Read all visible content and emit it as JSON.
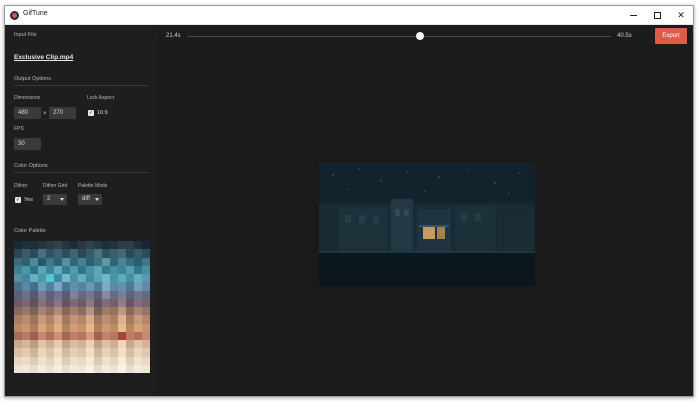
{
  "app": {
    "title": "GifTune",
    "icon": "app-logo-icon"
  },
  "window_controls": {
    "minimize_icon": "minimize-icon",
    "maximize_icon": "maximize-icon",
    "close_icon": "close-icon",
    "close_glyph": "✕"
  },
  "sidebar": {
    "input_file": {
      "section": "Input File",
      "filename": "Exclusive Clip.mp4"
    },
    "output_options": {
      "section": "Output Options",
      "dimensions_label": "Dimensions",
      "width": "480",
      "times": "×",
      "height": "270",
      "lock_aspect_label": "Lock Aspect",
      "lock_aspect_checked": true,
      "aspect_ratio": "16:9",
      "fps_label": "FPS",
      "fps": "30"
    },
    "color_options": {
      "section": "Color Options",
      "dither_label": "Dither",
      "dither_checked": true,
      "dither_value": "Yes",
      "dither_grid_label": "Dither Grid",
      "dither_grid_value": "2",
      "palette_mode_label": "Palette Mode",
      "palette_mode_value": "diff"
    },
    "color_palette": {
      "section": "Color Palette",
      "colors": [
        "#1b2a33",
        "#22323c",
        "#1f2f3a",
        "#27343d",
        "#2e3b44",
        "#34424c",
        "#253540",
        "#1c2b35",
        "#2a3842",
        "#31404a",
        "#263a45",
        "#1e303b",
        "#24343e",
        "#2c3b45",
        "#2f3e47",
        "#223039",
        "#1a2731",
        "#2b4552",
        "#3c5a68",
        "#2a4a5a",
        "#47707e",
        "#325263",
        "#3a6372",
        "#2c4d5e",
        "#3f6575",
        "#2d4757",
        "#365c6c",
        "#4a7383",
        "#2e5060",
        "#3b5f6e",
        "#426a7a",
        "#2b4858",
        "#375a69",
        "#2d4a58",
        "#3c6b7c",
        "#2f5e72",
        "#4d8a9a",
        "#28586c",
        "#3e7787",
        "#2a6477",
        "#55919f",
        "#30667a",
        "#47818f",
        "#2c5f73",
        "#3a7282",
        "#5b99a6",
        "#2e6579",
        "#4a8593",
        "#336d80",
        "#2c5c70",
        "#3f7686",
        "#3a7f93",
        "#4b97a8",
        "#2e7488",
        "#5aa5b4",
        "#3b8698",
        "#63a9b6",
        "#357d90",
        "#4f9aab",
        "#2f7588",
        "#4892a3",
        "#5da3b1",
        "#347b8e",
        "#46909f",
        "#3c8596",
        "#539dad",
        "#317789",
        "#4a8d9c",
        "#5b8fa0",
        "#3f88a0",
        "#6bb0bf",
        "#4a9ab0",
        "#5dc4d2",
        "#3c8aa3",
        "#7ab8c4",
        "#4b92a8",
        "#65aebf",
        "#3f8ba2",
        "#58a5b8",
        "#70b6c3",
        "#4795ab",
        "#5faabc",
        "#4a8fa5",
        "#68adbd",
        "#5a9aac",
        "#4d6f8a",
        "#5b87a6",
        "#43708f",
        "#6c9cb8",
        "#50809f",
        "#7aa8c0",
        "#4a7797",
        "#628fad",
        "#56839f",
        "#6a98b4",
        "#4e7c9c",
        "#7fa9c1",
        "#5a88a6",
        "#6691ae",
        "#4b7a99",
        "#739fb9",
        "#5e8aa7",
        "#5a5f78",
        "#6b6f8a",
        "#545a74",
        "#787b93",
        "#615f7a",
        "#6d7490",
        "#585d77",
        "#7e8199",
        "#63697f",
        "#72778f",
        "#5c6179",
        "#858aa0",
        "#676c84",
        "#7a7f96",
        "#5f647c",
        "#6e7389",
        "#656a82",
        "#6a5a66",
        "#7a6670",
        "#5f525e",
        "#86707a",
        "#705f6b",
        "#8a7680",
        "#665560",
        "#7c6a75",
        "#6c5c68",
        "#8e7884",
        "#62545f",
        "#7f6b76",
        "#745f6c",
        "#947d88",
        "#685762",
        "#826e79",
        "#75636f",
        "#8a6a5e",
        "#9c7768",
        "#7f6257",
        "#a88272",
        "#916f62",
        "#b08a78",
        "#866759",
        "#a47d6d",
        "#8c6b5e",
        "#b89280",
        "#7c5f54",
        "#a07a6a",
        "#93725f",
        "#bd9784",
        "#886a5c",
        "#a98473",
        "#977465",
        "#a87f64",
        "#b98c6e",
        "#9b745c",
        "#c69a78",
        "#ad8468",
        "#d2a582",
        "#a07a60",
        "#c29472",
        "#b08768",
        "#d8ac88",
        "#9c775d",
        "#be906f",
        "#ab8164",
        "#dcb18e",
        "#a47c61",
        "#c89b79",
        "#b3896b",
        "#b98a66",
        "#c8956e",
        "#ac7f5e",
        "#d6a37a",
        "#bf8f6b",
        "#e0ad84",
        "#b1835f",
        "#d09d75",
        "#c49270",
        "#e6b48b",
        "#ae805e",
        "#cc9873",
        "#bc8c68",
        "#e9b98f",
        "#b6885f",
        "#d5a27a",
        "#c6946e",
        "#a86a58",
        "#bb7a62",
        "#9c5f50",
        "#c8856b",
        "#b06f5b",
        "#d18f72",
        "#a36654",
        "#c07d66",
        "#b47562",
        "#d69a7c",
        "#a06253",
        "#c58269",
        "#b7785f",
        "#a8433c",
        "#c07a60",
        "#b56f5a",
        "#c28a70",
        "#c9a88c",
        "#d6b59a",
        "#bd9c82",
        "#e0c2a6",
        "#cfae92",
        "#e8caae",
        "#c4a387",
        "#dbbca0",
        "#d1b095",
        "#ecd0b4",
        "#c2a185",
        "#dfc0a4",
        "#cfae93",
        "#f0d6ba",
        "#c8a78b",
        "#e2c3a7",
        "#d4b398",
        "#d8c0a6",
        "#e2cbb1",
        "#cdb59c",
        "#ead4ba",
        "#dcc4aa",
        "#f0dac0",
        "#d2bba1",
        "#e6cfb5",
        "#ddc5ab",
        "#f2dcc2",
        "#d0b89e",
        "#e8d1b7",
        "#dac2a8",
        "#f4dfc5",
        "#d6bea4",
        "#ecd5bb",
        "#e0c8ae",
        "#e6d6c2",
        "#ecdcc8",
        "#dccbb7",
        "#f1e2ce",
        "#e4d3bf",
        "#f4e6d3",
        "#ddccb8",
        "#eedfcb",
        "#e8d8c4",
        "#f6e9d6",
        "#dac9b5",
        "#f0e1cd",
        "#e6d5c1",
        "#f8ecda",
        "#dfceba",
        "#f2e3cf",
        "#e9d9c5",
        "#efe3d4",
        "#f2e7d8",
        "#e8dccd",
        "#f5ebdd",
        "#ece0d1",
        "#f7eee1",
        "#e9ddce",
        "#f3e9db",
        "#efe4d5",
        "#f8f0e4",
        "#e6dacb",
        "#f4eadc",
        "#ede2d3",
        "#f9f2e7",
        "#eadecf",
        "#f5ecde",
        "#f0e5d6"
      ]
    }
  },
  "toolbar": {
    "start_time": "21.4s",
    "end_time": "40.5s",
    "scrub_position": 0.55,
    "export_label": "Export",
    "accent_color": "#e05a4a"
  },
  "preview": {
    "content": "animated-scene-preview"
  }
}
